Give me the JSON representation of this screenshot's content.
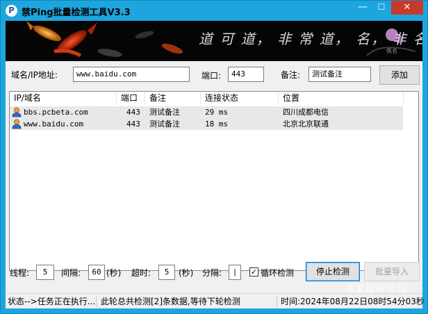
{
  "window": {
    "title": "禁Ping批量检测工具V3.3",
    "min_glyph": "—",
    "max_glyph": "☐",
    "close_glyph": "✕"
  },
  "banner": {
    "calligraphy": "道 可 道， 非 常 道， 名， 非 名",
    "signature": "佚名"
  },
  "form": {
    "domain_label": "域名/IP地址:",
    "domain_value": "www.baidu.com",
    "port_label": "端口:",
    "port_value": "443",
    "note_label": "备注:",
    "note_value": "测试备注",
    "add_button": "添加"
  },
  "table": {
    "columns": [
      "IP/域名",
      "端口",
      "备注",
      "连接状态",
      "位置"
    ],
    "rows": [
      {
        "host": "bbs.pcbeta.com",
        "port": "443",
        "note": "测试备注",
        "status": "29 ms",
        "location": "四川成都电信"
      },
      {
        "host": "www.baidu.com",
        "port": "443",
        "note": "测试备注",
        "status": "18 ms",
        "location": "北京北京联通"
      }
    ]
  },
  "controls": {
    "threads_label": "线程:",
    "threads_value": "5",
    "interval_label": "间隔:",
    "interval_value": "60",
    "interval_unit": "(秒)",
    "timeout_label": "超时:",
    "timeout_value": "5",
    "timeout_unit": "(秒)",
    "separator_label": "分隔:",
    "separator_value": "|",
    "loop_checked": true,
    "loop_label": "循环检测",
    "stop_button": "停止检测",
    "import_button": "批量导入"
  },
  "status": {
    "state": "状态-->任务正在执行...",
    "summary": "此轮总共检测[2]条数据,等待下轮检测",
    "time": "时间:2024年08月22日08时54分03秒"
  },
  "watermark": "吾爱破解论坛",
  "colors": {
    "title_bar": "#1da6de",
    "close_button": "#c7392b",
    "row_highlight": "#e8e8e8",
    "focus_border": "#0078d7"
  },
  "icons": {
    "app": "p-logo-icon",
    "row": "user-icon"
  }
}
